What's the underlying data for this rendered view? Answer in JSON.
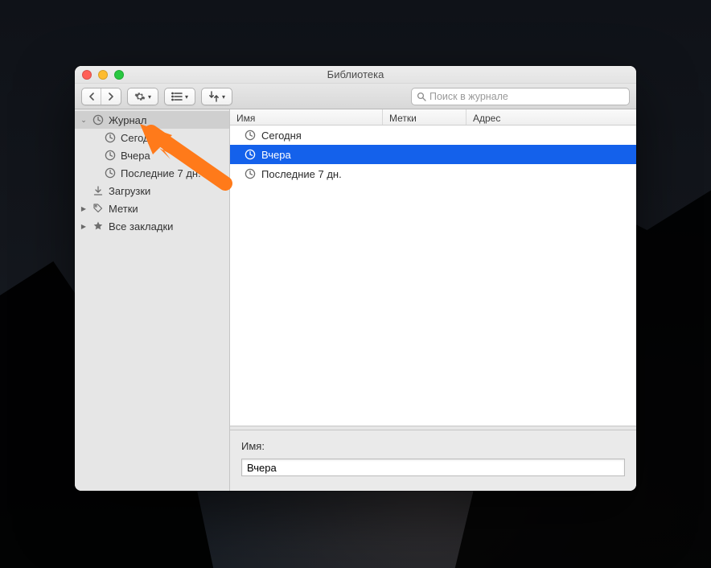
{
  "window": {
    "title": "Библиотека"
  },
  "search": {
    "placeholder": "Поиск в журнале"
  },
  "columns": {
    "name": "Имя",
    "tags": "Метки",
    "addr": "Адрес"
  },
  "sidebar": {
    "journal": {
      "label": "Журнал"
    },
    "journal_children": [
      {
        "label": "Сегодня"
      },
      {
        "label": "Вчера"
      },
      {
        "label": "Последние 7 дн."
      }
    ],
    "downloads": {
      "label": "Загрузки"
    },
    "tags": {
      "label": "Метки"
    },
    "allBookmarks": {
      "label": "Все закладки"
    }
  },
  "rows": [
    {
      "label": "Сегодня",
      "selected": false
    },
    {
      "label": "Вчера",
      "selected": true
    },
    {
      "label": "Последние 7 дн.",
      "selected": false
    }
  ],
  "detail": {
    "label": "Имя:",
    "value": "Вчера"
  }
}
